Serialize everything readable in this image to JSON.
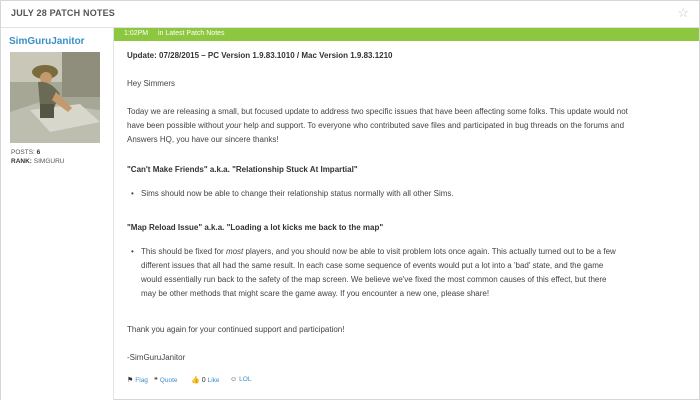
{
  "thread": {
    "title": "JULY 28 PATCH NOTES",
    "star_icon": "star-icon"
  },
  "author": {
    "username": "SimGuruJanitor",
    "posts_label": "POSTS:",
    "posts_value": "6",
    "rank_label": "RANK:",
    "rank_value": "SIMGURU"
  },
  "post": {
    "time": "1:02PM",
    "category": "in Latest Patch Notes",
    "update_line": "Update: 07/28/2015 – PC Version 1.9.83.1010 / Mac Version 1.9.83.1210",
    "greeting": "Hey Simmers",
    "intro_1": "Today we are releasing a small, but focused update to address two specific issues that have been affecting some folks. This update would not",
    "intro_2a": "have been possible without ",
    "intro_2b": "your",
    "intro_2c": " help and support. To everyone who contributed save files and participated in bug threads on the forums and",
    "intro_3": "Answers HQ, you have our sincere thanks!",
    "section1_title": "\"Can't Make Friends\" a.k.a. \"Relationship Stuck At Impartial\"",
    "section1_bullet": "Sims should now be able to change their relationship status normally with all other Sims.",
    "section2_title": "\"Map Reload Issue\" a.k.a. \"Loading a lot kicks me back to the map\"",
    "section2_b1a": "This should be fixed for ",
    "section2_b1b": "most",
    "section2_b1c": " players, and you should now be able to visit problem lots once again. This actually turned out to be a few",
    "section2_b2": "different issues that all had the same result. In each case some sequence of events would put a lot into a 'bad' state, and the game",
    "section2_b3": "would essentially run back to the safety of the map screen. We believe we've fixed the most common causes of this effect, but there",
    "section2_b4": "may be other methods that might scare the game away. If you encounter a new one, please share!",
    "closing": "Thank you again for your continued support and participation!",
    "signature": "-SimGuruJanitor"
  },
  "actions": {
    "flag": "Flag",
    "quote": "Quote",
    "like_count": "0",
    "like": "Like",
    "lol": "LOL"
  },
  "colors": {
    "header_green": "#8dc63f",
    "link_blue": "#3a8fc7"
  }
}
